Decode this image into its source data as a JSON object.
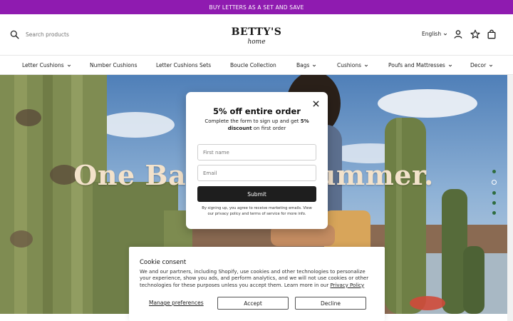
{
  "announcement": "BUY LETTERS AS A SET AND SAVE",
  "header": {
    "search_placeholder": "Search products",
    "logo_top": "BETTY'S",
    "logo_bottom": "home",
    "language": "English"
  },
  "nav": {
    "items": [
      {
        "label": "Letter Cushions",
        "dropdown": true
      },
      {
        "label": "Number Cushions",
        "dropdown": false
      },
      {
        "label": "Letter Cushions Sets",
        "dropdown": false
      },
      {
        "label": "Boucle Collection",
        "dropdown": false
      },
      {
        "label": "Bags",
        "dropdown": true
      },
      {
        "label": "Cushions",
        "dropdown": true
      },
      {
        "label": "Poufs and Mattresses",
        "dropdown": true
      },
      {
        "label": "Decor",
        "dropdown": true
      }
    ]
  },
  "hero": {
    "title": "One Bag. One Summer.",
    "slide_count": 5,
    "active_slide": 2
  },
  "popup": {
    "title": "5% off entire order",
    "subtitle_pre": "Complete the form to sign up and get ",
    "subtitle_bold": "5% discount",
    "subtitle_post": " on first order",
    "first_name_placeholder": "First name",
    "email_placeholder": "Email",
    "submit_label": "Submit",
    "legal": "By signing up, you agree to receive marketing emails. View our privacy policy and terms of service for more info."
  },
  "cookie": {
    "title": "Cookie consent",
    "text": "We and our partners, including Shopify, use cookies and other technologies to personalize your experience, show you ads, and perform analytics, and we will not use cookies or other technologies for these purposes unless you accept them. Learn more in our ",
    "link": "Privacy Policy",
    "manage_label": "Manage preferences",
    "accept_label": "Accept",
    "decline_label": "Decline"
  },
  "colors": {
    "announcement_bg": "#8f1bb0",
    "hero_title": "#f3e2cb",
    "slide_dot": "#2f6c3f",
    "submit_bg": "#1e1e1e"
  }
}
